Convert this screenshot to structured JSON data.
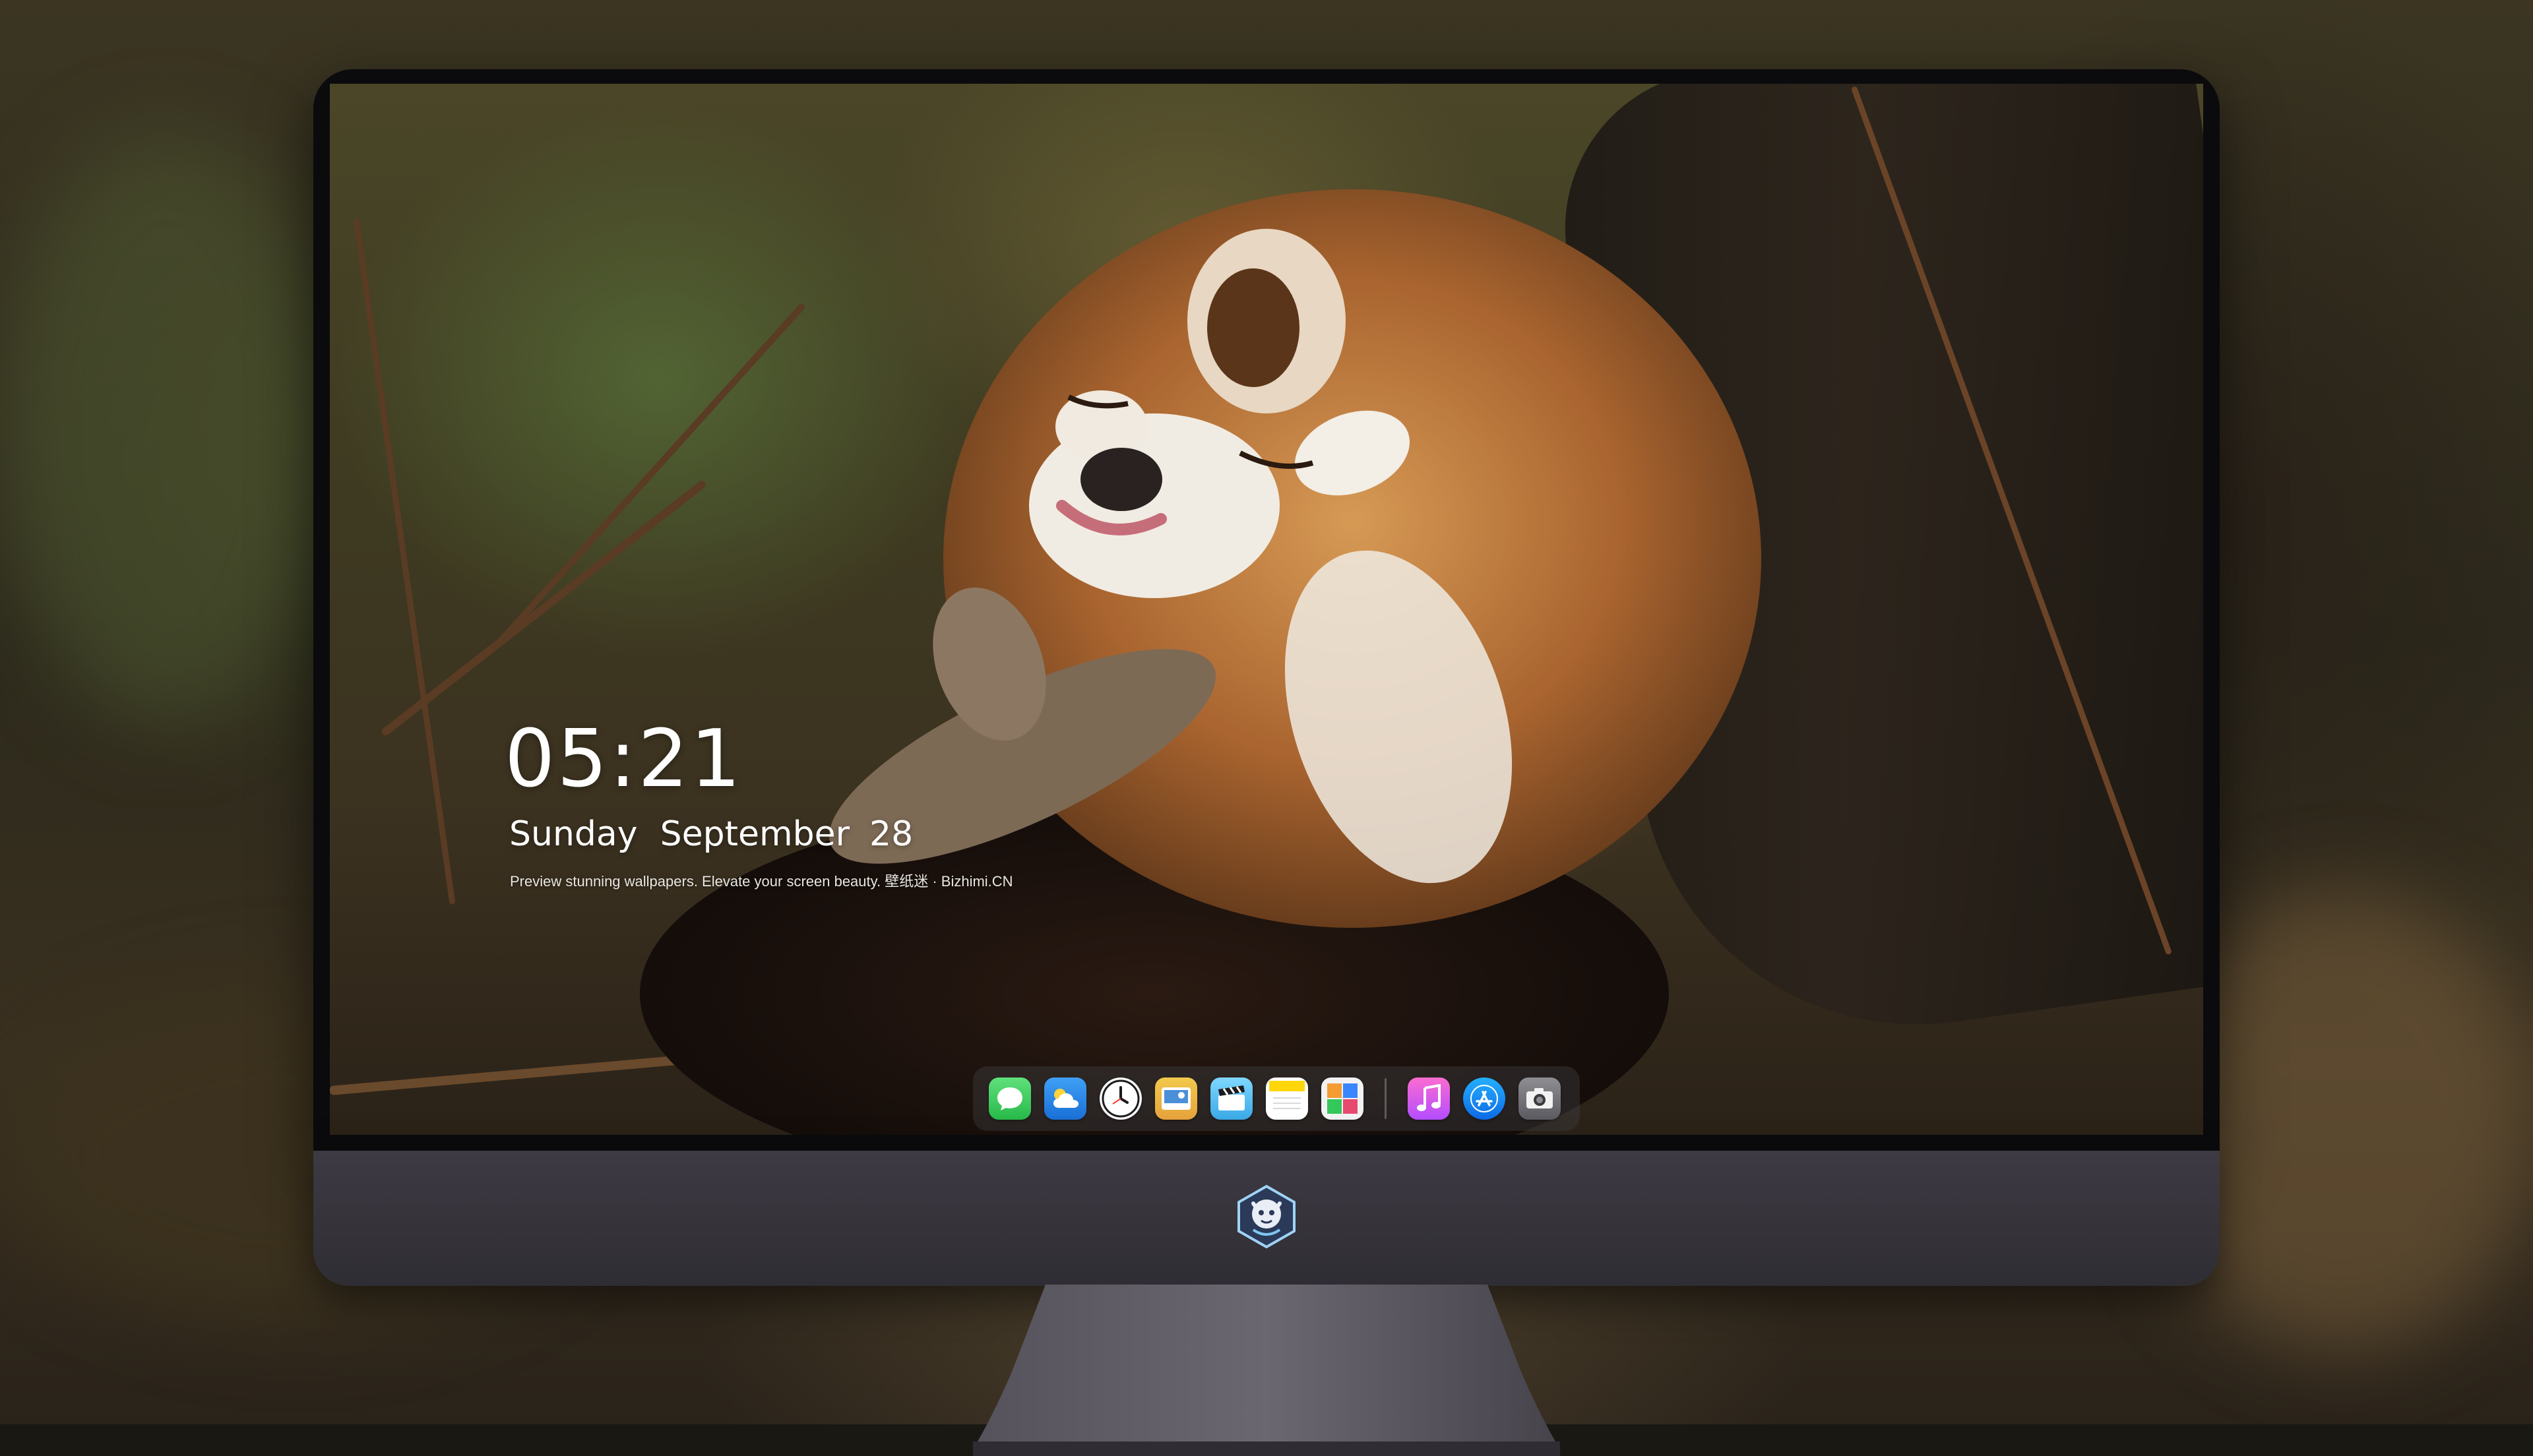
{
  "lockscreen": {
    "time": "05:21",
    "day": "Sunday",
    "month": "September",
    "date": "28",
    "caption": "Preview stunning wallpapers. Elevate your screen beauty. 壁纸迷 · Bizhimi.CN"
  },
  "dock": {
    "apps": [
      {
        "name": "messages",
        "icon": "message-bubble-icon",
        "color": "#34c759"
      },
      {
        "name": "weather",
        "icon": "cloud-sun-icon",
        "color": "#2f8cf0"
      },
      {
        "name": "clock",
        "icon": "clock-icon",
        "color": "#1c1c1e"
      },
      {
        "name": "preview",
        "icon": "photo-viewer-icon",
        "color": "#4a90d9"
      },
      {
        "name": "clips",
        "icon": "clapperboard-icon",
        "color": "#5ac8fa"
      },
      {
        "name": "notes",
        "icon": "notes-icon",
        "color": "#ffd60a"
      },
      {
        "name": "photo-booth",
        "icon": "photo-grid-icon",
        "color": "#e9e9e9"
      },
      {
        "name": "music",
        "icon": "music-note-icon",
        "color": "#f74fb4"
      },
      {
        "name": "app-store",
        "icon": "app-store-icon",
        "color": "#1a8cff"
      },
      {
        "name": "camera",
        "icon": "camera-icon",
        "color": "#6d6d72"
      }
    ]
  },
  "monitor": {
    "logo": "bizhimi-mascot-logo"
  }
}
